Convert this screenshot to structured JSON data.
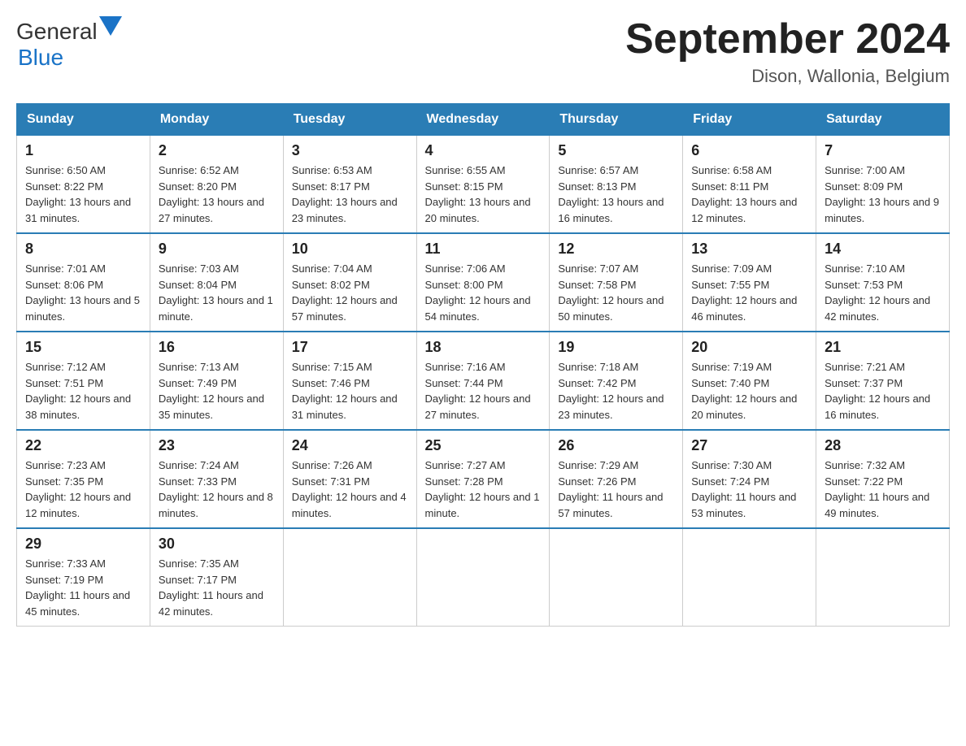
{
  "header": {
    "logo_general": "General",
    "logo_blue": "Blue",
    "month_title": "September 2024",
    "location": "Dison, Wallonia, Belgium"
  },
  "days_of_week": [
    "Sunday",
    "Monday",
    "Tuesday",
    "Wednesday",
    "Thursday",
    "Friday",
    "Saturday"
  ],
  "weeks": [
    [
      {
        "day": "1",
        "sunrise": "6:50 AM",
        "sunset": "8:22 PM",
        "daylight": "13 hours and 31 minutes."
      },
      {
        "day": "2",
        "sunrise": "6:52 AM",
        "sunset": "8:20 PM",
        "daylight": "13 hours and 27 minutes."
      },
      {
        "day": "3",
        "sunrise": "6:53 AM",
        "sunset": "8:17 PM",
        "daylight": "13 hours and 23 minutes."
      },
      {
        "day": "4",
        "sunrise": "6:55 AM",
        "sunset": "8:15 PM",
        "daylight": "13 hours and 20 minutes."
      },
      {
        "day": "5",
        "sunrise": "6:57 AM",
        "sunset": "8:13 PM",
        "daylight": "13 hours and 16 minutes."
      },
      {
        "day": "6",
        "sunrise": "6:58 AM",
        "sunset": "8:11 PM",
        "daylight": "13 hours and 12 minutes."
      },
      {
        "day": "7",
        "sunrise": "7:00 AM",
        "sunset": "8:09 PM",
        "daylight": "13 hours and 9 minutes."
      }
    ],
    [
      {
        "day": "8",
        "sunrise": "7:01 AM",
        "sunset": "8:06 PM",
        "daylight": "13 hours and 5 minutes."
      },
      {
        "day": "9",
        "sunrise": "7:03 AM",
        "sunset": "8:04 PM",
        "daylight": "13 hours and 1 minute."
      },
      {
        "day": "10",
        "sunrise": "7:04 AM",
        "sunset": "8:02 PM",
        "daylight": "12 hours and 57 minutes."
      },
      {
        "day": "11",
        "sunrise": "7:06 AM",
        "sunset": "8:00 PM",
        "daylight": "12 hours and 54 minutes."
      },
      {
        "day": "12",
        "sunrise": "7:07 AM",
        "sunset": "7:58 PM",
        "daylight": "12 hours and 50 minutes."
      },
      {
        "day": "13",
        "sunrise": "7:09 AM",
        "sunset": "7:55 PM",
        "daylight": "12 hours and 46 minutes."
      },
      {
        "day": "14",
        "sunrise": "7:10 AM",
        "sunset": "7:53 PM",
        "daylight": "12 hours and 42 minutes."
      }
    ],
    [
      {
        "day": "15",
        "sunrise": "7:12 AM",
        "sunset": "7:51 PM",
        "daylight": "12 hours and 38 minutes."
      },
      {
        "day": "16",
        "sunrise": "7:13 AM",
        "sunset": "7:49 PM",
        "daylight": "12 hours and 35 minutes."
      },
      {
        "day": "17",
        "sunrise": "7:15 AM",
        "sunset": "7:46 PM",
        "daylight": "12 hours and 31 minutes."
      },
      {
        "day": "18",
        "sunrise": "7:16 AM",
        "sunset": "7:44 PM",
        "daylight": "12 hours and 27 minutes."
      },
      {
        "day": "19",
        "sunrise": "7:18 AM",
        "sunset": "7:42 PM",
        "daylight": "12 hours and 23 minutes."
      },
      {
        "day": "20",
        "sunrise": "7:19 AM",
        "sunset": "7:40 PM",
        "daylight": "12 hours and 20 minutes."
      },
      {
        "day": "21",
        "sunrise": "7:21 AM",
        "sunset": "7:37 PM",
        "daylight": "12 hours and 16 minutes."
      }
    ],
    [
      {
        "day": "22",
        "sunrise": "7:23 AM",
        "sunset": "7:35 PM",
        "daylight": "12 hours and 12 minutes."
      },
      {
        "day": "23",
        "sunrise": "7:24 AM",
        "sunset": "7:33 PM",
        "daylight": "12 hours and 8 minutes."
      },
      {
        "day": "24",
        "sunrise": "7:26 AM",
        "sunset": "7:31 PM",
        "daylight": "12 hours and 4 minutes."
      },
      {
        "day": "25",
        "sunrise": "7:27 AM",
        "sunset": "7:28 PM",
        "daylight": "12 hours and 1 minute."
      },
      {
        "day": "26",
        "sunrise": "7:29 AM",
        "sunset": "7:26 PM",
        "daylight": "11 hours and 57 minutes."
      },
      {
        "day": "27",
        "sunrise": "7:30 AM",
        "sunset": "7:24 PM",
        "daylight": "11 hours and 53 minutes."
      },
      {
        "day": "28",
        "sunrise": "7:32 AM",
        "sunset": "7:22 PM",
        "daylight": "11 hours and 49 minutes."
      }
    ],
    [
      {
        "day": "29",
        "sunrise": "7:33 AM",
        "sunset": "7:19 PM",
        "daylight": "11 hours and 45 minutes."
      },
      {
        "day": "30",
        "sunrise": "7:35 AM",
        "sunset": "7:17 PM",
        "daylight": "11 hours and 42 minutes."
      },
      null,
      null,
      null,
      null,
      null
    ]
  ]
}
